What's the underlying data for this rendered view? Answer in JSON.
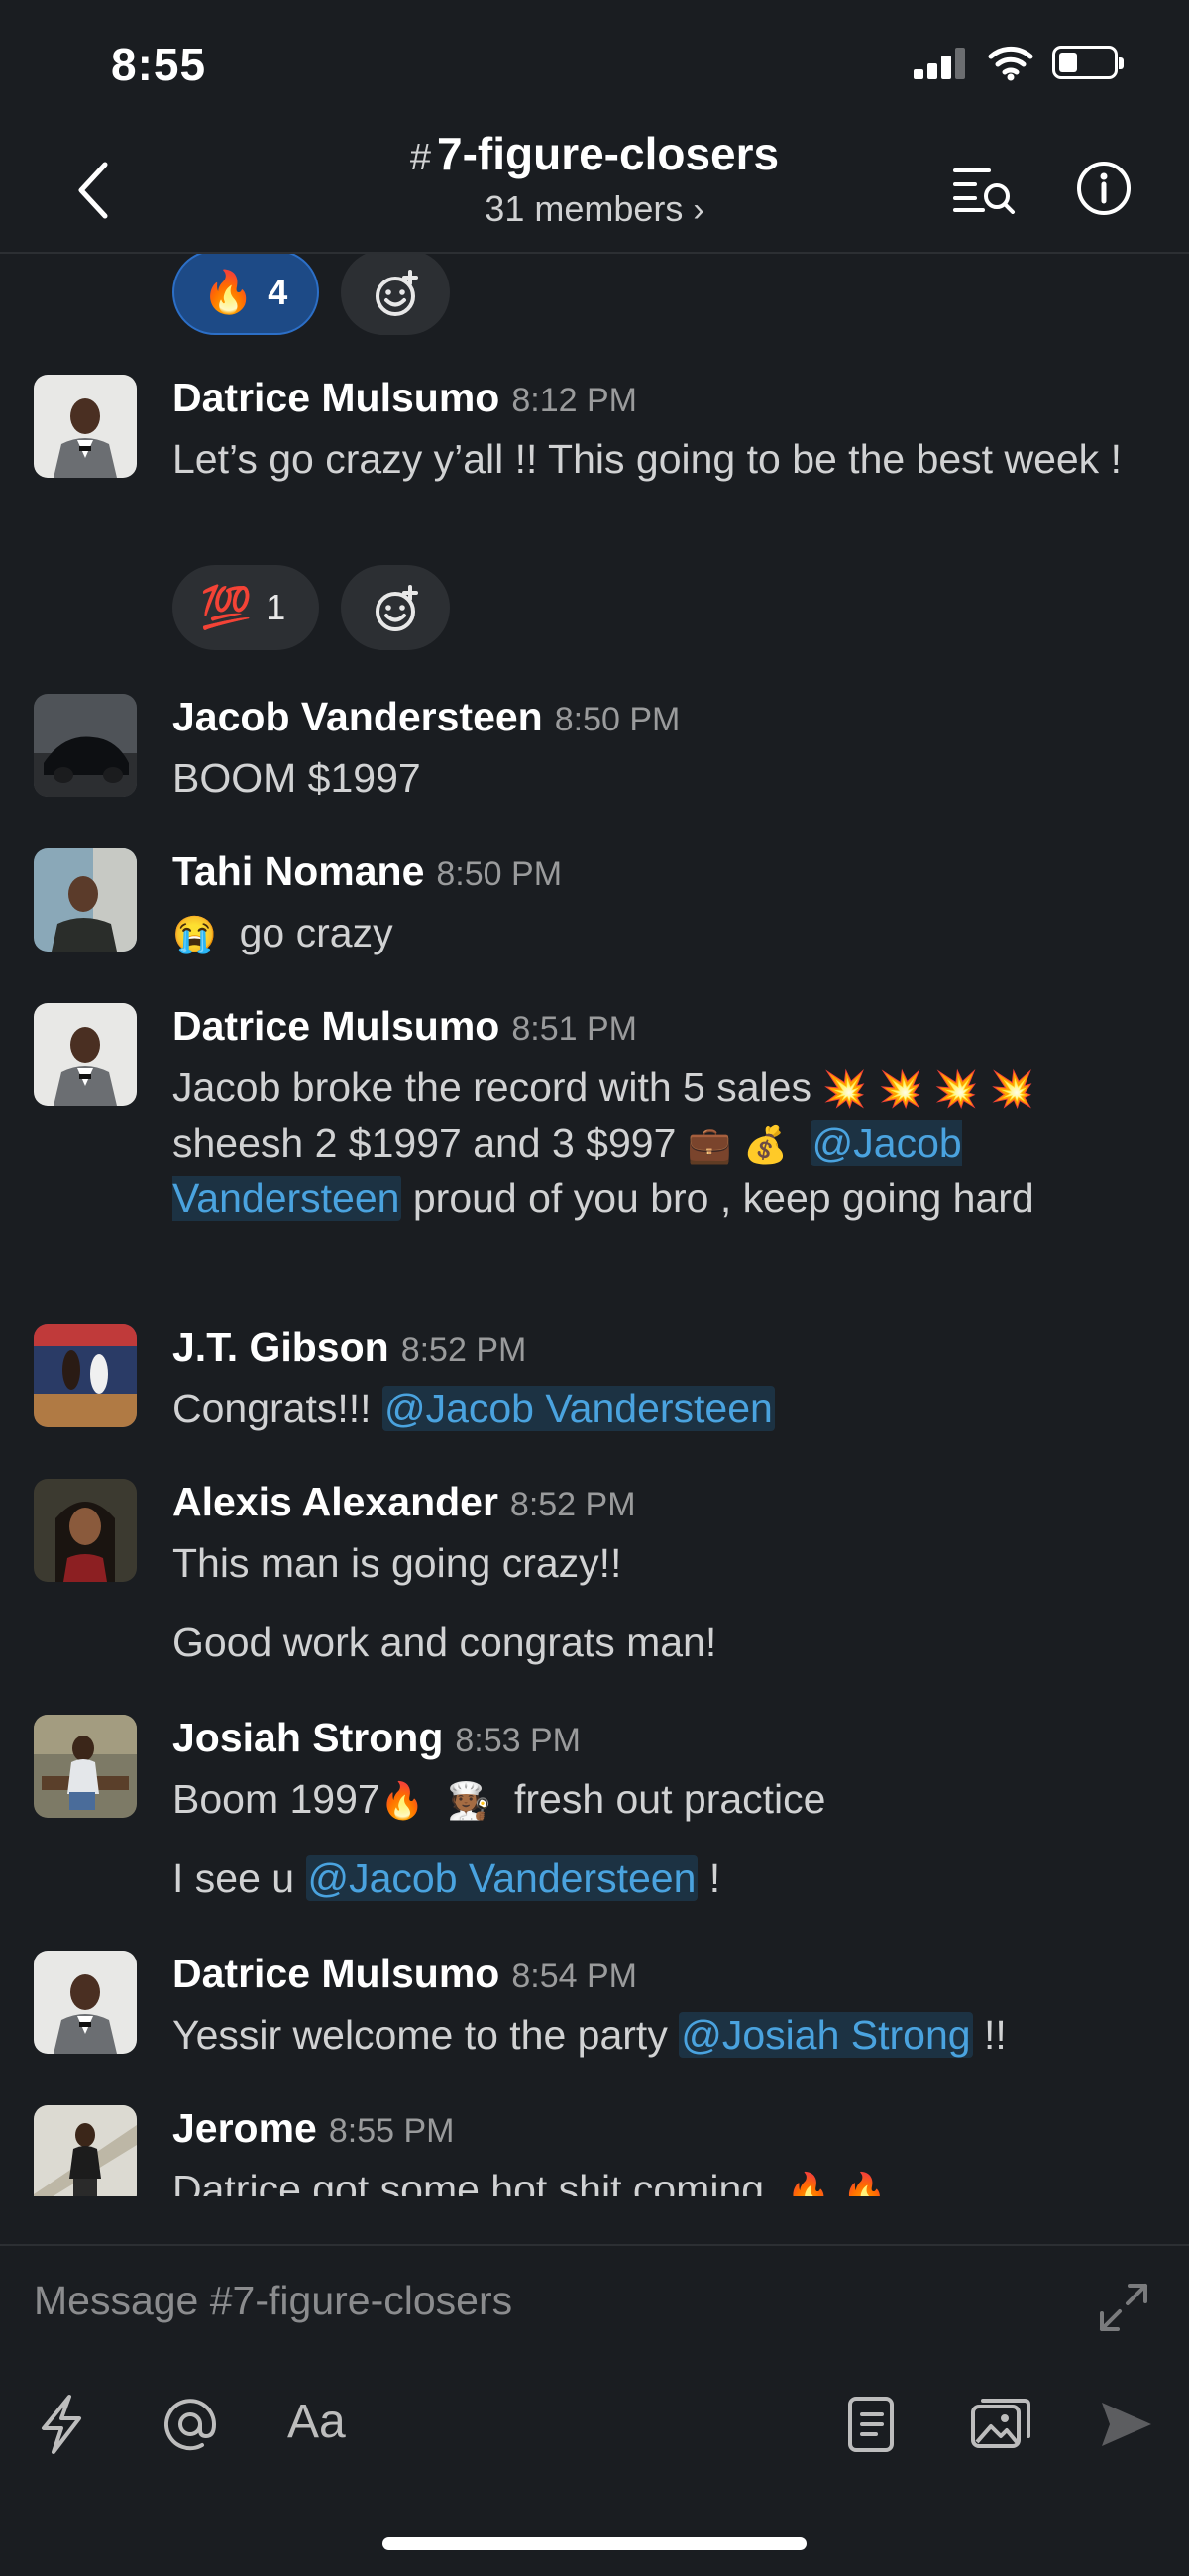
{
  "status_bar": {
    "time": "8:55"
  },
  "header": {
    "hash": "#",
    "channel_name": "7-figure-closers",
    "members": "31 members",
    "members_chevron": "›"
  },
  "top_reactions": [
    {
      "emoji": "🔥",
      "count": "4",
      "active": true
    }
  ],
  "messages": [
    {
      "author": "Datrice Mulsumo",
      "time": "8:12 PM",
      "text": "Let’s go crazy y’all !! This going to be the best week !",
      "reactions": [
        {
          "emoji": "💯",
          "count": "1"
        }
      ]
    },
    {
      "author": "Jacob Vandersteen",
      "time": "8:50 PM",
      "text": "BOOM $1997"
    },
    {
      "author": "Tahi Nomane",
      "time": "8:50 PM",
      "emoji": "😭",
      "text": "go crazy"
    },
    {
      "author": "Datrice Mulsumo",
      "time": "8:51 PM",
      "parts": {
        "a": "Jacob broke the record with 5 sales",
        "boom": "💥",
        "b": "sheesh 2 $1997 and 3 $997",
        "briefcase": "💼",
        "money_bag": "💰",
        "mention": "@Jacob Vandersteen",
        "c": "proud of you bro , keep going hard"
      }
    },
    {
      "author": "J.T. Gibson",
      "time": "8:52 PM",
      "text": "Congrats!!!",
      "mention": "@Jacob Vandersteen"
    },
    {
      "author": "Alexis Alexander",
      "time": "8:52 PM",
      "text": "This man is going crazy!!",
      "text2": "Good work and congrats man!"
    },
    {
      "author": "Josiah Strong",
      "time": "8:53 PM",
      "text_a": "Boom 1997",
      "fire": "🔥",
      "cook": "🧑🏾‍🍳",
      "text_b": "fresh out practice",
      "line2_a": "I see u",
      "mention": "@Jacob Vandersteen",
      "line2_b": "!"
    },
    {
      "author": "Datrice Mulsumo",
      "time": "8:54 PM",
      "text": "Yessir welcome to the party",
      "mention": "@Josiah Strong",
      "text_end": "!!"
    },
    {
      "author": "Jerome",
      "time": "8:55 PM",
      "text": "Datrice got some hot shit coming",
      "fire": "🔥"
    }
  ],
  "composer": {
    "placeholder": "Message #7-figure-closers",
    "format_label": "Aa"
  },
  "colors": {
    "background": "#1a1d21",
    "mention": "#4aa3df",
    "reaction_active": "#1d4a86"
  }
}
